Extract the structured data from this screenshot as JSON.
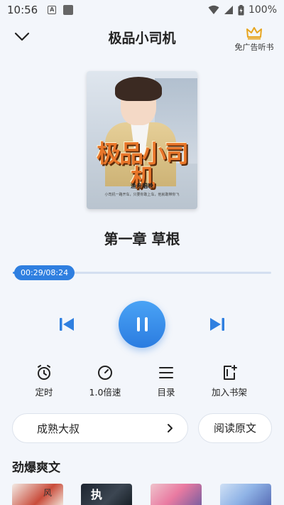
{
  "status_bar": {
    "time": "10:56",
    "battery": "100%"
  },
  "header": {
    "title": "极品小司机",
    "vip_label": "免广告听书"
  },
  "cover": {
    "title": "极品小司机",
    "author": "渔舟唱晚",
    "tagline": "小司机一路开车，只要你敢上车，他就敢带你飞"
  },
  "chapter": {
    "title": "第一章 草根"
  },
  "player": {
    "time_display": "00:29/08:24",
    "progress_fraction": 0.057,
    "accent_color": "#2f7fe0"
  },
  "functions": [
    {
      "label": "定时",
      "icon": "alarm-clock-icon"
    },
    {
      "label": "1.0倍速",
      "icon": "speed-gauge-icon"
    },
    {
      "label": "目录",
      "icon": "menu-list-icon"
    },
    {
      "label": "加入书架",
      "icon": "add-bookshelf-icon"
    }
  ],
  "voice": {
    "label": "成熟大叔"
  },
  "read_original": {
    "label": "阅读原文"
  },
  "recommend": {
    "section_title": "劲爆爽文",
    "items": [
      {
        "cover_text": "风"
      },
      {
        "cover_text": "执"
      },
      {
        "cover_text": ""
      },
      {
        "cover_text": ""
      }
    ]
  }
}
